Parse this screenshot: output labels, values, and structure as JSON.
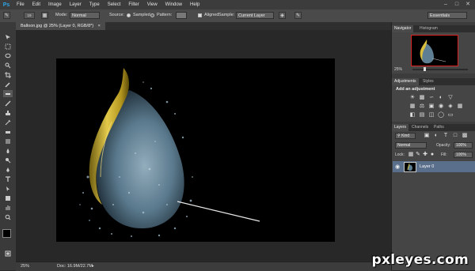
{
  "app": {
    "logo": "Ps"
  },
  "menu": [
    "File",
    "Edit",
    "Image",
    "Layer",
    "Type",
    "Select",
    "Filter",
    "View",
    "Window",
    "Help"
  ],
  "window_buttons": [
    "–",
    "□",
    "✕"
  ],
  "options": {
    "brush_size": "19",
    "mode_label": "Mode:",
    "mode_value": "Normal",
    "source_label": "Source:",
    "sampled_label": "Sampled",
    "pattern_label": "Pattern:",
    "aligned_label": "Aligned",
    "sample_label": "Sample:",
    "sample_value": "Current Layer",
    "workspace": "Essentials"
  },
  "document": {
    "tab_title": "Balloon.jpg @ 25% (Layer 0, RGB/8*)"
  },
  "status": {
    "zoom": "25%",
    "doc_info": "Doc: 16.9M/22.7M"
  },
  "panels": {
    "navigator": {
      "tabs": [
        "Navigator",
        "Histogram"
      ],
      "zoom": "25%"
    },
    "adjustments": {
      "tabs": [
        "Adjustments",
        "Styles"
      ],
      "heading": "Add an adjustment"
    },
    "layers": {
      "tabs": [
        "Layers",
        "Channels",
        "Paths"
      ],
      "kind": "Kind",
      "blend_mode": "Normal",
      "opacity_label": "Opacity:",
      "opacity_value": "100%",
      "lock_label": "Lock:",
      "fill_label": "Fill:",
      "fill_value": "100%",
      "layer_names": [
        "Layer 0"
      ]
    }
  },
  "watermark": "pxleyes.com"
}
